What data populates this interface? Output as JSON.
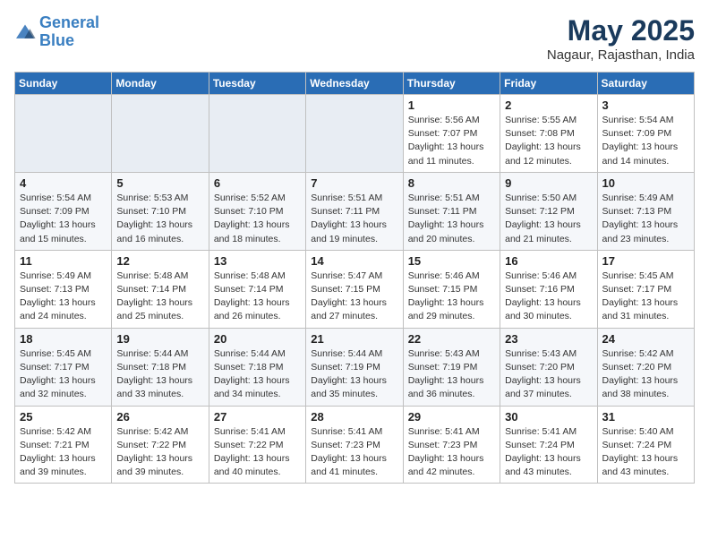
{
  "logo": {
    "line1": "General",
    "line2": "Blue"
  },
  "title": "May 2025",
  "location": "Nagaur, Rajasthan, India",
  "weekdays": [
    "Sunday",
    "Monday",
    "Tuesday",
    "Wednesday",
    "Thursday",
    "Friday",
    "Saturday"
  ],
  "weeks": [
    [
      {
        "day": "",
        "sunrise": "",
        "sunset": "",
        "daylight": ""
      },
      {
        "day": "",
        "sunrise": "",
        "sunset": "",
        "daylight": ""
      },
      {
        "day": "",
        "sunrise": "",
        "sunset": "",
        "daylight": ""
      },
      {
        "day": "",
        "sunrise": "",
        "sunset": "",
        "daylight": ""
      },
      {
        "day": "1",
        "sunrise": "Sunrise: 5:56 AM",
        "sunset": "Sunset: 7:07 PM",
        "daylight": "Daylight: 13 hours and 11 minutes."
      },
      {
        "day": "2",
        "sunrise": "Sunrise: 5:55 AM",
        "sunset": "Sunset: 7:08 PM",
        "daylight": "Daylight: 13 hours and 12 minutes."
      },
      {
        "day": "3",
        "sunrise": "Sunrise: 5:54 AM",
        "sunset": "Sunset: 7:09 PM",
        "daylight": "Daylight: 13 hours and 14 minutes."
      }
    ],
    [
      {
        "day": "4",
        "sunrise": "Sunrise: 5:54 AM",
        "sunset": "Sunset: 7:09 PM",
        "daylight": "Daylight: 13 hours and 15 minutes."
      },
      {
        "day": "5",
        "sunrise": "Sunrise: 5:53 AM",
        "sunset": "Sunset: 7:10 PM",
        "daylight": "Daylight: 13 hours and 16 minutes."
      },
      {
        "day": "6",
        "sunrise": "Sunrise: 5:52 AM",
        "sunset": "Sunset: 7:10 PM",
        "daylight": "Daylight: 13 hours and 18 minutes."
      },
      {
        "day": "7",
        "sunrise": "Sunrise: 5:51 AM",
        "sunset": "Sunset: 7:11 PM",
        "daylight": "Daylight: 13 hours and 19 minutes."
      },
      {
        "day": "8",
        "sunrise": "Sunrise: 5:51 AM",
        "sunset": "Sunset: 7:11 PM",
        "daylight": "Daylight: 13 hours and 20 minutes."
      },
      {
        "day": "9",
        "sunrise": "Sunrise: 5:50 AM",
        "sunset": "Sunset: 7:12 PM",
        "daylight": "Daylight: 13 hours and 21 minutes."
      },
      {
        "day": "10",
        "sunrise": "Sunrise: 5:49 AM",
        "sunset": "Sunset: 7:13 PM",
        "daylight": "Daylight: 13 hours and 23 minutes."
      }
    ],
    [
      {
        "day": "11",
        "sunrise": "Sunrise: 5:49 AM",
        "sunset": "Sunset: 7:13 PM",
        "daylight": "Daylight: 13 hours and 24 minutes."
      },
      {
        "day": "12",
        "sunrise": "Sunrise: 5:48 AM",
        "sunset": "Sunset: 7:14 PM",
        "daylight": "Daylight: 13 hours and 25 minutes."
      },
      {
        "day": "13",
        "sunrise": "Sunrise: 5:48 AM",
        "sunset": "Sunset: 7:14 PM",
        "daylight": "Daylight: 13 hours and 26 minutes."
      },
      {
        "day": "14",
        "sunrise": "Sunrise: 5:47 AM",
        "sunset": "Sunset: 7:15 PM",
        "daylight": "Daylight: 13 hours and 27 minutes."
      },
      {
        "day": "15",
        "sunrise": "Sunrise: 5:46 AM",
        "sunset": "Sunset: 7:15 PM",
        "daylight": "Daylight: 13 hours and 29 minutes."
      },
      {
        "day": "16",
        "sunrise": "Sunrise: 5:46 AM",
        "sunset": "Sunset: 7:16 PM",
        "daylight": "Daylight: 13 hours and 30 minutes."
      },
      {
        "day": "17",
        "sunrise": "Sunrise: 5:45 AM",
        "sunset": "Sunset: 7:17 PM",
        "daylight": "Daylight: 13 hours and 31 minutes."
      }
    ],
    [
      {
        "day": "18",
        "sunrise": "Sunrise: 5:45 AM",
        "sunset": "Sunset: 7:17 PM",
        "daylight": "Daylight: 13 hours and 32 minutes."
      },
      {
        "day": "19",
        "sunrise": "Sunrise: 5:44 AM",
        "sunset": "Sunset: 7:18 PM",
        "daylight": "Daylight: 13 hours and 33 minutes."
      },
      {
        "day": "20",
        "sunrise": "Sunrise: 5:44 AM",
        "sunset": "Sunset: 7:18 PM",
        "daylight": "Daylight: 13 hours and 34 minutes."
      },
      {
        "day": "21",
        "sunrise": "Sunrise: 5:44 AM",
        "sunset": "Sunset: 7:19 PM",
        "daylight": "Daylight: 13 hours and 35 minutes."
      },
      {
        "day": "22",
        "sunrise": "Sunrise: 5:43 AM",
        "sunset": "Sunset: 7:19 PM",
        "daylight": "Daylight: 13 hours and 36 minutes."
      },
      {
        "day": "23",
        "sunrise": "Sunrise: 5:43 AM",
        "sunset": "Sunset: 7:20 PM",
        "daylight": "Daylight: 13 hours and 37 minutes."
      },
      {
        "day": "24",
        "sunrise": "Sunrise: 5:42 AM",
        "sunset": "Sunset: 7:20 PM",
        "daylight": "Daylight: 13 hours and 38 minutes."
      }
    ],
    [
      {
        "day": "25",
        "sunrise": "Sunrise: 5:42 AM",
        "sunset": "Sunset: 7:21 PM",
        "daylight": "Daylight: 13 hours and 39 minutes."
      },
      {
        "day": "26",
        "sunrise": "Sunrise: 5:42 AM",
        "sunset": "Sunset: 7:22 PM",
        "daylight": "Daylight: 13 hours and 39 minutes."
      },
      {
        "day": "27",
        "sunrise": "Sunrise: 5:41 AM",
        "sunset": "Sunset: 7:22 PM",
        "daylight": "Daylight: 13 hours and 40 minutes."
      },
      {
        "day": "28",
        "sunrise": "Sunrise: 5:41 AM",
        "sunset": "Sunset: 7:23 PM",
        "daylight": "Daylight: 13 hours and 41 minutes."
      },
      {
        "day": "29",
        "sunrise": "Sunrise: 5:41 AM",
        "sunset": "Sunset: 7:23 PM",
        "daylight": "Daylight: 13 hours and 42 minutes."
      },
      {
        "day": "30",
        "sunrise": "Sunrise: 5:41 AM",
        "sunset": "Sunset: 7:24 PM",
        "daylight": "Daylight: 13 hours and 43 minutes."
      },
      {
        "day": "31",
        "sunrise": "Sunrise: 5:40 AM",
        "sunset": "Sunset: 7:24 PM",
        "daylight": "Daylight: 13 hours and 43 minutes."
      }
    ]
  ]
}
